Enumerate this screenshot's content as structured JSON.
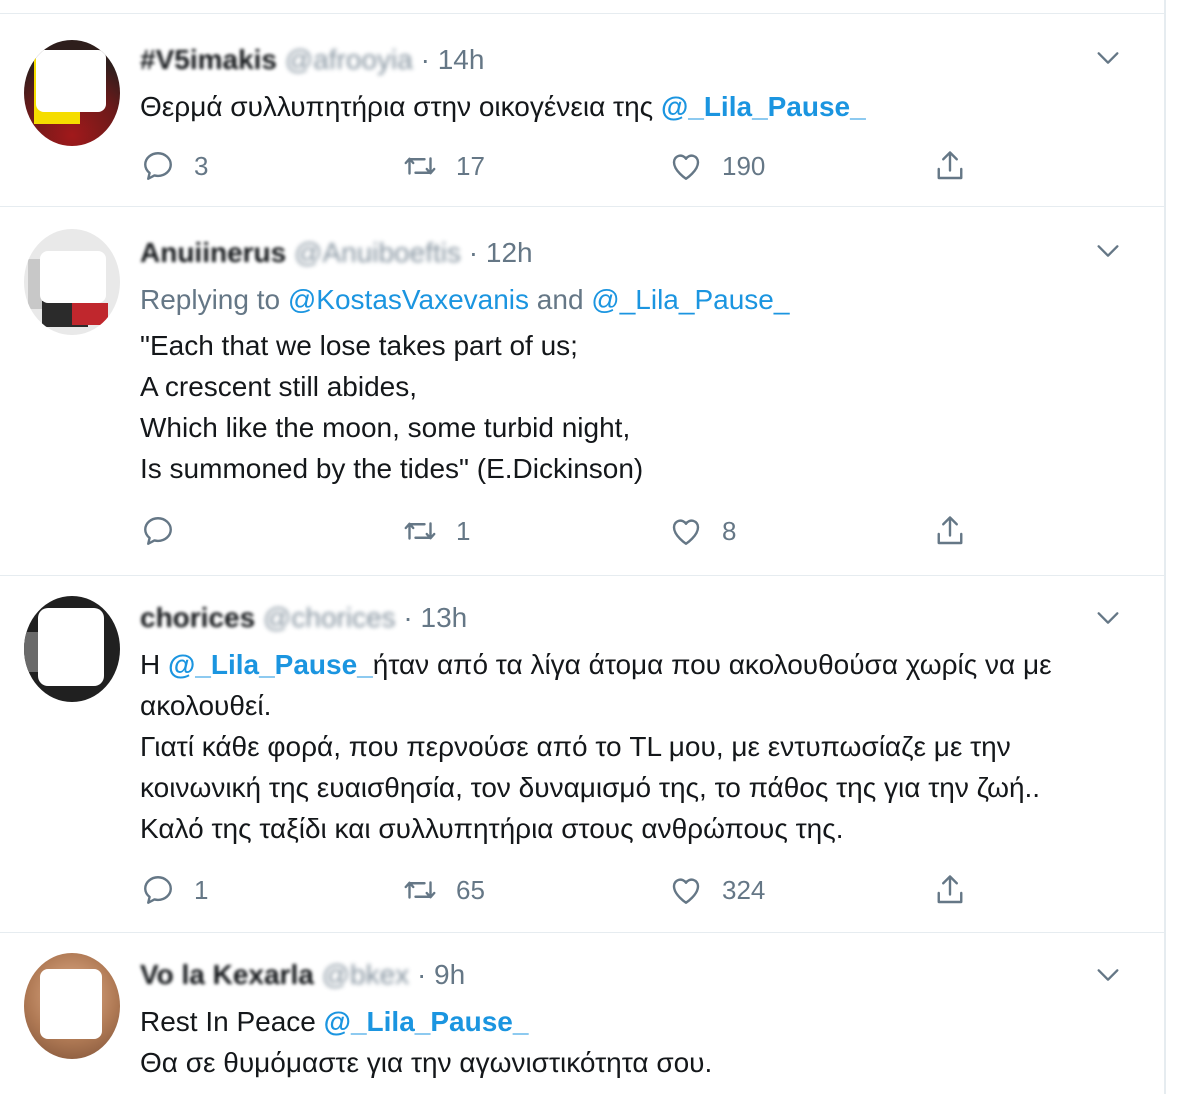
{
  "tweets": [
    {
      "name": "#V5imakis",
      "handle": "@afrooyia",
      "dot": "·",
      "time": "14h",
      "text_before": "Θερμά συλλυπητήρια στην οικογένεια της ",
      "mention": "@_Lila_Pause_",
      "replies": "3",
      "retweets": "17",
      "likes": "190"
    },
    {
      "name": "Anuiinerus",
      "handle": "@Anuiboeftis",
      "dot": "·",
      "time": "12h",
      "replying_label": "Replying to",
      "replying_user1": "@KostasVaxevanis",
      "replying_and": "and",
      "replying_user2": "@_Lila_Pause_",
      "lines": [
        "\"Each that we lose takes part of us;",
        "A crescent still abides,",
        "Which like the moon, some turbid night,",
        "Is summoned by the tides\" (E.Dickinson)"
      ],
      "replies": "",
      "retweets": "1",
      "likes": "8"
    },
    {
      "name": "chorices",
      "handle": "@chorices",
      "dot": "·",
      "time": "13h",
      "line1_prefix": "Η ",
      "mention": "@_Lila_Pause_",
      "line1_suffix": "ήταν από τα λίγα άτομα που ακολουθούσα χωρίς να με",
      "lines": [
        "ακολουθεί.",
        "Γιατί κάθε φορά, που περνούσε από το TL μου, με εντυπωσίαζε με την",
        "κοινωνική της ευαισθησία, τον δυναμισμό της, το πάθος της για την ζωή..",
        "Καλό της ταξίδι και συλλυπητήρια στους ανθρώπους της."
      ],
      "replies": "1",
      "retweets": "65",
      "likes": "324"
    },
    {
      "name": "Vo la Kexarla",
      "handle": "@bkex",
      "dot": "·",
      "time": "9h",
      "line1_prefix": "Rest In Peace ",
      "mention": "@_Lila_Pause_",
      "lines": [
        "Θα σε θυμόμαστε για την αγωνιστικότητα  σου."
      ]
    }
  ],
  "icons": {
    "reply": "reply-icon",
    "retweet": "retweet-icon",
    "like": "heart-icon",
    "share": "share-icon",
    "more": "chevron-down-icon"
  },
  "colors": {
    "link": "#1b95e0",
    "secondary": "#657786",
    "text": "#14171a",
    "border": "#e6ecf0"
  }
}
